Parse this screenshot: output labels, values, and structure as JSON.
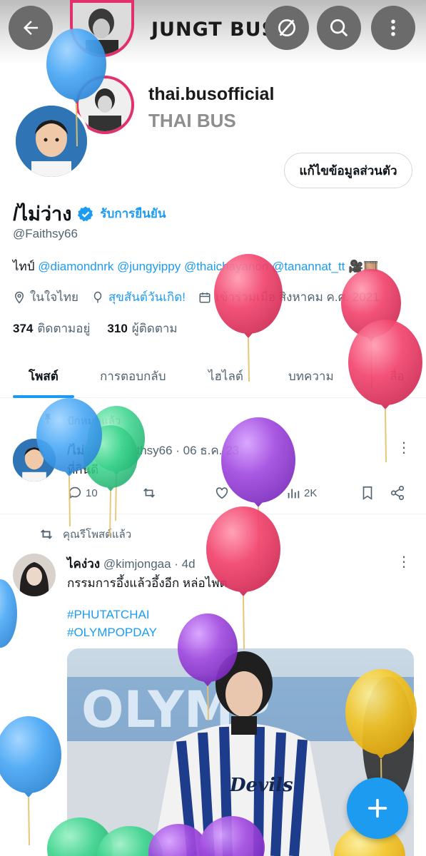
{
  "header": {
    "title": "JUNGT BUS",
    "username": "thai.busofficial",
    "username_sub": "THAI BUS",
    "icons": [
      "back-arrow-icon",
      "grok-icon",
      "search-icon",
      "more-vertical-icon"
    ]
  },
  "profile": {
    "edit_button": "แก้ไขข้อมูลส่วนตัว",
    "display_name": "/ไม่ว่าง",
    "verified_label": "รับการยืนยัน",
    "handle": "@Faithsy66",
    "bio_prefix": "ไทป์",
    "bio_mentions": [
      "@diamondnrk",
      "@jungyippy",
      "@thaichayanon",
      "@tanannat_tt"
    ],
    "bio_suffix": "🎥🎞️",
    "location": "ในใจไทย",
    "website": "สุขสันต์วันเกิด!",
    "joined": "เข้าร่วมเมื่อ สิงหาคม ค.ศ. 2021",
    "following_count": "374",
    "following_label": "ติดตามอยู่",
    "followers_count": "310",
    "followers_label": "ผู้ติดตาม"
  },
  "tabs": [
    {
      "label": "โพสต์",
      "active": true
    },
    {
      "label": "การตอบกลับ",
      "active": false
    },
    {
      "label": "ไฮไลต์",
      "active": false
    },
    {
      "label": "บทความ",
      "active": false
    },
    {
      "label": "สื่อ",
      "active": false
    }
  ],
  "pinned_tweet": {
    "pinned_label": "ปักหมุดแล้ว",
    "name": "/ไม่ว่าง",
    "handle_time": "@Faithsy66 · 06 ธ.ค. 23",
    "text": "ที่กินดี",
    "replies": "10",
    "views": "2K"
  },
  "retweet": {
    "label": "คุณรีโพสต์แล้ว",
    "name": "ไคง่วง",
    "handle_time": "@kimjongaa · 4d",
    "text": "กรรมการอึ้งแล้วอึ้งอีก หล่อไพต",
    "hashtags": [
      "#PHUTATCHAI",
      "#OLYMPOPDAY"
    ],
    "media_caption": "Devils"
  },
  "colors": {
    "accent": "#1d9bf0",
    "text": "#0f1419",
    "muted": "#536471",
    "balloon_blue": "#4aa8f5",
    "balloon_pink": "#f2456e",
    "balloon_purple": "#a24be0",
    "balloon_green": "#3fd58f",
    "balloon_yellow": "#f6c82a"
  }
}
